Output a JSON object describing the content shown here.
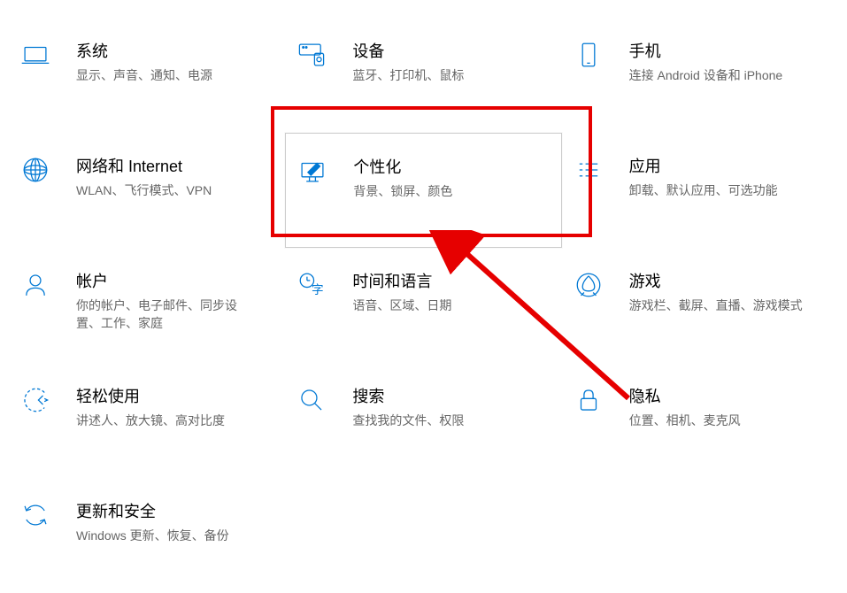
{
  "tiles": [
    {
      "title": "系统",
      "desc": "显示、声音、通知、电源",
      "icon": "laptop-icon"
    },
    {
      "title": "设备",
      "desc": "蓝牙、打印机、鼠标",
      "icon": "devices-icon"
    },
    {
      "title": "手机",
      "desc": "连接 Android 设备和 iPhone",
      "icon": "phone-icon"
    },
    {
      "title": "网络和 Internet",
      "desc": "WLAN、飞行模式、VPN",
      "icon": "network-icon"
    },
    {
      "title": "个性化",
      "desc": "背景、锁屏、颜色",
      "icon": "personalization-icon"
    },
    {
      "title": "应用",
      "desc": "卸载、默认应用、可选功能",
      "icon": "apps-icon"
    },
    {
      "title": "帐户",
      "desc": "你的帐户、电子邮件、同步设置、工作、家庭",
      "icon": "accounts-icon"
    },
    {
      "title": "时间和语言",
      "desc": "语音、区域、日期",
      "icon": "time-language-icon"
    },
    {
      "title": "游戏",
      "desc": "游戏栏、截屏、直播、游戏模式",
      "icon": "gaming-icon"
    },
    {
      "title": "轻松使用",
      "desc": "讲述人、放大镜、高对比度",
      "icon": "ease-of-access-icon"
    },
    {
      "title": "搜索",
      "desc": "查找我的文件、权限",
      "icon": "search-icon"
    },
    {
      "title": "隐私",
      "desc": "位置、相机、麦克风",
      "icon": "privacy-icon"
    },
    {
      "title": "更新和安全",
      "desc": "Windows 更新、恢复、备份",
      "icon": "update-security-icon"
    }
  ],
  "annotation": {
    "highlighted_index": 4
  }
}
